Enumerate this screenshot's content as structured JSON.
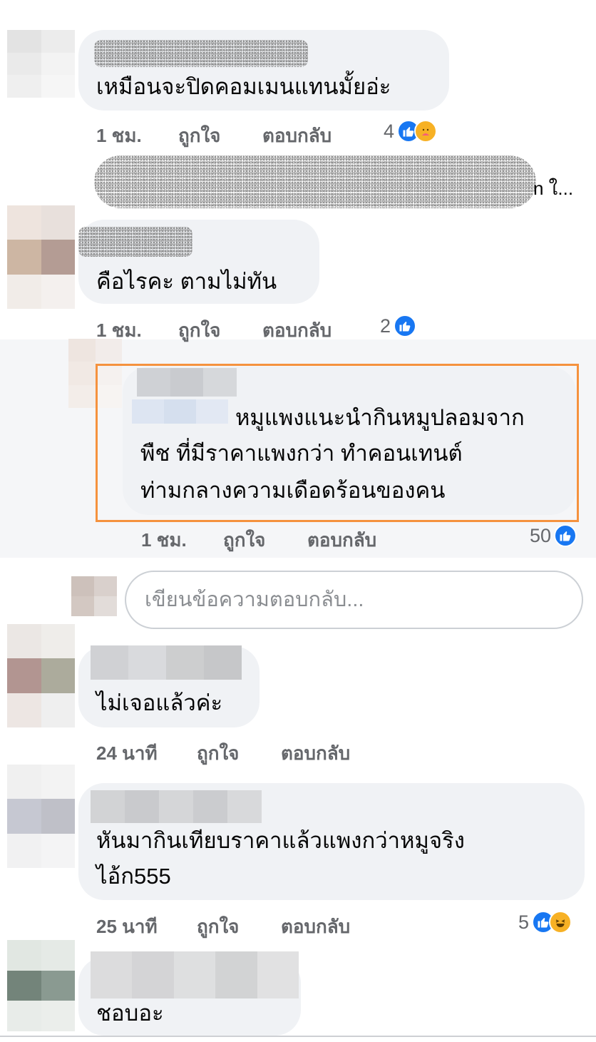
{
  "colors": {
    "bubble": "#f0f2f5",
    "meta_text": "#65676b",
    "like_blue": "#1877f2",
    "highlight_orange": "#f5923e"
  },
  "comments": [
    {
      "text": "เหมือนจะปิดคอมเมนแทนมั้ยอ่ะ",
      "time": "1 ชม.",
      "like_label": "ถูกใจ",
      "reply_label": "ตอบกลับ",
      "reaction_count": "4",
      "reaction_icons": [
        "like-icon",
        "care-icon"
      ],
      "nested_preview_tail": "n ใ..."
    },
    {
      "text": "คือไรคะ ตามไม่ทัน",
      "time": "1 ชม.",
      "like_label": "ถูกใจ",
      "reply_label": "ตอบกลับ",
      "reaction_count": "2",
      "reaction_icons": [
        "like-icon"
      ]
    },
    {
      "line1": "หมูแพงแนะนำกินหมูปลอมจาก",
      "line2": "พืช ที่มีราคาแพงกว่า ทำคอนเทนต์",
      "line3": "ท่ามกลางความเดือดร้อนของคน",
      "time": "1 ชม.",
      "like_label": "ถูกใจ",
      "reply_label": "ตอบกลับ",
      "reaction_count": "50",
      "reaction_icons": [
        "like-icon"
      ]
    },
    {
      "text": "ไม่เจอแล้วค่ะ",
      "time": "24 นาที",
      "like_label": "ถูกใจ",
      "reply_label": "ตอบกลับ"
    },
    {
      "line1": "หันมากินเทียบราคาแล้วแพงกว่าหมูจริง",
      "line2": "ไอ้ก555",
      "time": "25 นาที",
      "like_label": "ถูกใจ",
      "reply_label": "ตอบกลับ",
      "reaction_count": "5",
      "reaction_icons": [
        "like-icon",
        "haha-icon"
      ]
    },
    {
      "text": "ชอบอะ"
    }
  ],
  "reply_box": {
    "placeholder": "เขียนข้อความตอบกลับ..."
  }
}
